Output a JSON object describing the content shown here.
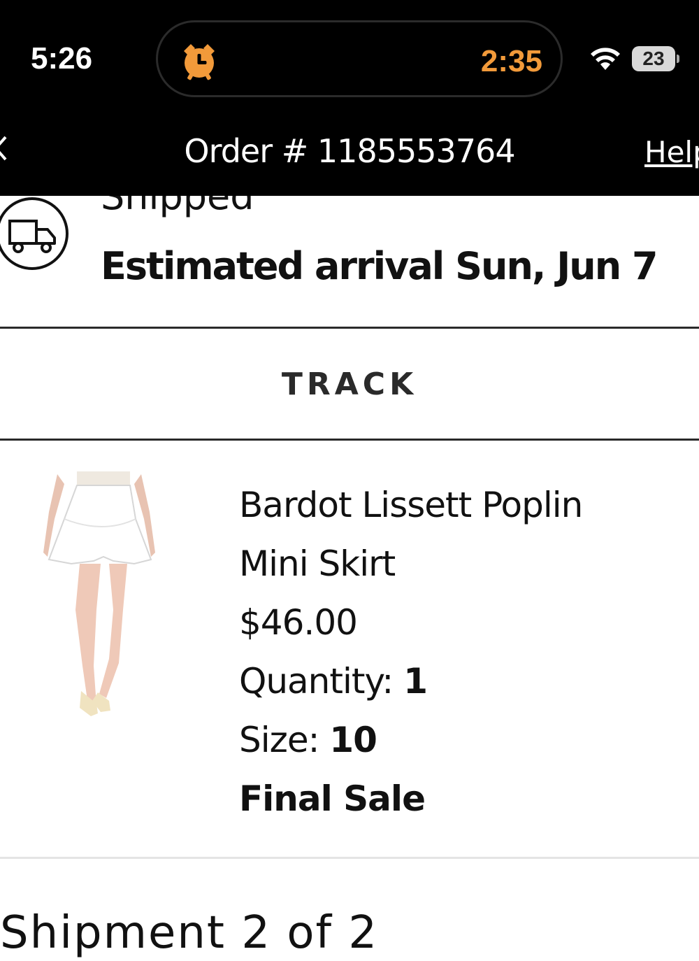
{
  "status_bar": {
    "time": "5:26",
    "timer": "2:35",
    "battery_level": "23",
    "icons": [
      "alarm-clock-icon",
      "wifi-icon",
      "battery-icon"
    ],
    "accent_color": "#f29a3a"
  },
  "header": {
    "title": "Order # 1185553764",
    "help_label": "Help",
    "back_icon": "chevron-left-icon"
  },
  "shipment": {
    "status": "Shipped",
    "estimated_arrival": "Estimated arrival Sun, Jun 7",
    "icon": "delivery-truck-icon",
    "track_label": "TRACK"
  },
  "product": {
    "name_line1": "Bardot Lissett Poplin",
    "name_line2": "Mini Skirt",
    "price": "$46.00",
    "quantity_label": "Quantity:",
    "quantity_value": "1",
    "size_label": "Size:",
    "size_value": "10",
    "sale_note": "Final Sale"
  },
  "next_section": {
    "heading": "Shipment 2 of 2"
  }
}
